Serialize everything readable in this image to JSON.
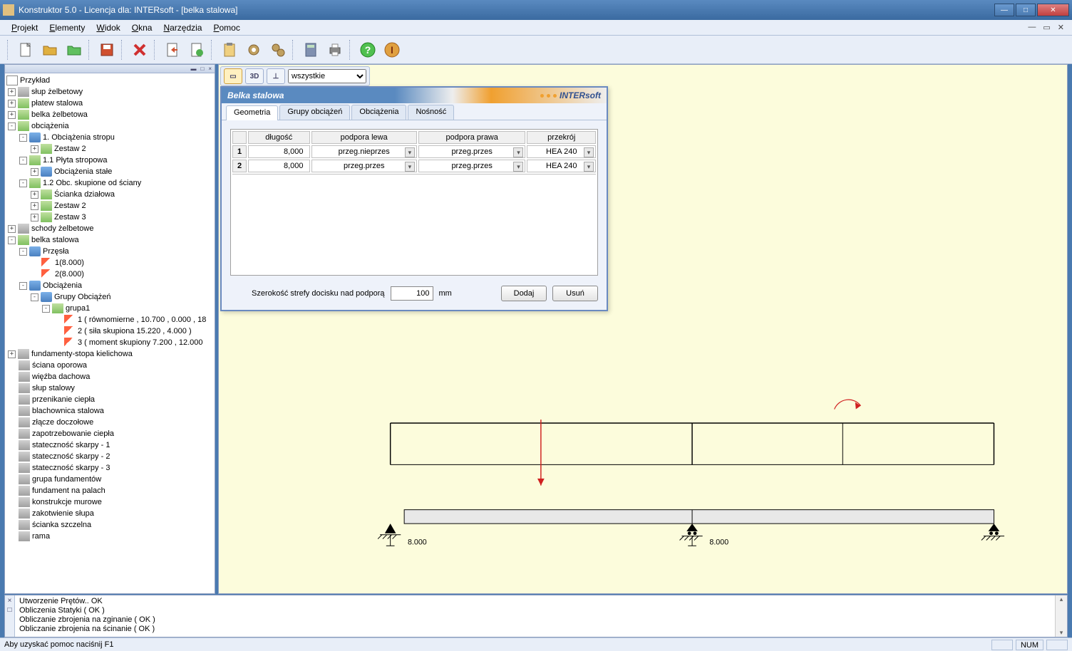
{
  "window": {
    "title": "Konstruktor 5.0 - Licencja dla: INTERsoft - [belka stalowa]"
  },
  "menu": {
    "projekt": "Projekt",
    "elementy": "Elementy",
    "widok": "Widok",
    "okna": "Okna",
    "narzedzia": "Narzędzia",
    "pomoc": "Pomoc"
  },
  "mainToolbar": {
    "filter": "wszystkie",
    "btn3d": "3D"
  },
  "tree": {
    "root": "Przykład",
    "items": [
      "słup żelbetowy",
      "płatew stalowa",
      "belka żelbetowa",
      "obciążenia",
      "1. Obciążenia stropu",
      "Zestaw 2",
      "1.1 Płyta stropowa",
      "Obciążenia stałe",
      "1.2 Obc. skupione od ściany",
      "Ścianka działowa",
      "Zestaw 2",
      "Zestaw 3",
      "schody żelbetowe",
      "belka stalowa",
      "Przęsła",
      "1(8.000)",
      "2(8.000)",
      "Obciążenia",
      "Grupy Obciążeń",
      "grupa1",
      "1 ( równomierne , 10.700 , 0.000 , 18",
      "2 ( siła skupiona  15.220 , 4.000  )",
      "3 ( moment skupiony  7.200 , 12.000",
      "fundamenty-stopa kielichowa",
      "ściana oporowa",
      "więźba dachowa",
      "słup stalowy",
      "przenikanie ciepła",
      "blachownica stalowa",
      "złącze doczołowe",
      "zapotrzebowanie ciepła",
      "stateczność skarpy - 1",
      "stateczność skarpy - 2",
      "stateczność skarpy - 3",
      "grupa fundamentów",
      "fundament na palach",
      "konstrukcje murowe",
      "zakotwienie słupa",
      "ścianka szczelna",
      "rama"
    ]
  },
  "dialog": {
    "title": "Belka stalowa",
    "brand": "INTERsoft",
    "tabs": {
      "geometria": "Geometria",
      "grupy": "Grupy obciążeń",
      "obciazenia": "Obciążenia",
      "nosnosc": "Nośność"
    },
    "table": {
      "headers": {
        "dlugosc": "długość",
        "podporaLewa": "podpora lewa",
        "podporaPrawa": "podpora prawa",
        "przekroj": "przekrój"
      },
      "rows": [
        {
          "n": "1",
          "dlugosc": "8,000",
          "lewa": "przeg.nieprzes",
          "prawa": "przeg.przes",
          "przekroj": "HEA 240"
        },
        {
          "n": "2",
          "dlugosc": "8,000",
          "lewa": "przeg.przes",
          "prawa": "przeg.przes",
          "przekroj": "HEA 240"
        }
      ]
    },
    "bottom": {
      "label": "Szerokość strefy docisku nad podporą",
      "value": "100",
      "unit": "mm",
      "dodaj": "Dodaj",
      "usun": "Usuń"
    }
  },
  "beam": {
    "dim1": "8.000",
    "dim2": "8.000"
  },
  "log": {
    "l1": "Utworzenie Prętów..  OK",
    "l2": "Obliczenia Statyki  ( OK )",
    "l3": "Obliczanie zbrojenia na zginanie  ( OK )",
    "l4": "Obliczanie zbrojenia na ścinanie ( OK )"
  },
  "status": {
    "help": "Aby uzyskać pomoc naciśnij F1",
    "num": "NUM"
  }
}
